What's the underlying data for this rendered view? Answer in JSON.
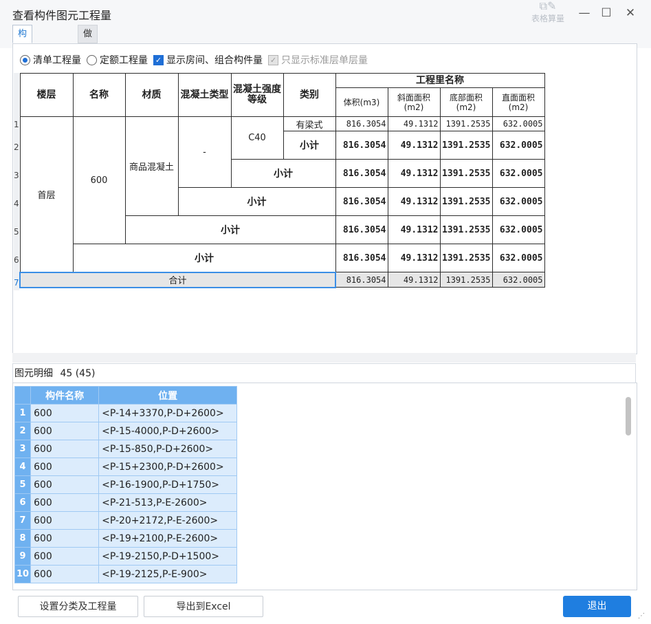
{
  "window": {
    "title": "查看构件图元工程量",
    "controls": {
      "minimize": "—",
      "maximize": "☐",
      "close": "✕"
    }
  },
  "background_toolbar": {
    "label": "表格算量",
    "icon": "edit-table-icon"
  },
  "tabs": [
    {
      "label": "构件工程量",
      "active": true
    },
    {
      "label": "做法工程量",
      "active": false
    }
  ],
  "options": {
    "radio_list": "清单工程量",
    "radio_quota": "定额工程量",
    "show_rooms": "显示房间、组合构件量",
    "standard_floor": "只显示标准层单层量"
  },
  "qty_table": {
    "headers": {
      "floor": "楼层",
      "name": "名称",
      "material": "材质",
      "concrete_type": "混凝土类型",
      "strength": "混凝土强度等级",
      "category": "类别",
      "group": "工程里名称",
      "volume": "体积(m3)",
      "slope_area": "斜面面积(m2)",
      "bottom_area": "底部面积(m2)",
      "vertical_area": "直面面积(m2)"
    },
    "row_numbers": [
      "1",
      "2",
      "3",
      "4",
      "5",
      "6",
      "7"
    ],
    "floor": "首层",
    "name": "600",
    "material": "商品混凝土",
    "concrete_type": "-",
    "strength": "C40",
    "category": "有梁式",
    "subtotal_label": "小计",
    "total_label": "合计",
    "detail_values": [
      "816.3054",
      "49.1312",
      "1391.2535",
      "632.0005"
    ],
    "subtotal_values": [
      "816.3054",
      "49.1312",
      "1391.2535",
      "632.0005"
    ],
    "total_values": [
      "816.3054",
      "49.1312",
      "1391.2535",
      "632.0005"
    ]
  },
  "detail": {
    "title": "图元明细",
    "count": "45 (45)",
    "columns": [
      "构件名称",
      "位置"
    ],
    "rows": [
      {
        "idx": "1",
        "name": "600",
        "pos": "<P-14+3370,P-D+2600>"
      },
      {
        "idx": "2",
        "name": "600",
        "pos": "<P-15-4000,P-D+2600>"
      },
      {
        "idx": "3",
        "name": "600",
        "pos": "<P-15-850,P-D+2600>"
      },
      {
        "idx": "4",
        "name": "600",
        "pos": "<P-15+2300,P-D+2600>"
      },
      {
        "idx": "5",
        "name": "600",
        "pos": "<P-16-1900,P-D+1750>"
      },
      {
        "idx": "6",
        "name": "600",
        "pos": "<P-21-513,P-E-2600>"
      },
      {
        "idx": "7",
        "name": "600",
        "pos": "<P-20+2172,P-E-2600>"
      },
      {
        "idx": "8",
        "name": "600",
        "pos": "<P-19+2100,P-E-2600>"
      },
      {
        "idx": "9",
        "name": "600",
        "pos": "<P-19-2150,P-D+1500>"
      },
      {
        "idx": "10",
        "name": "600",
        "pos": "<P-19-2125,P-E-900>"
      }
    ]
  },
  "buttons": {
    "settings": "设置分类及工程量",
    "export": "导出到Excel",
    "exit": "退出"
  }
}
